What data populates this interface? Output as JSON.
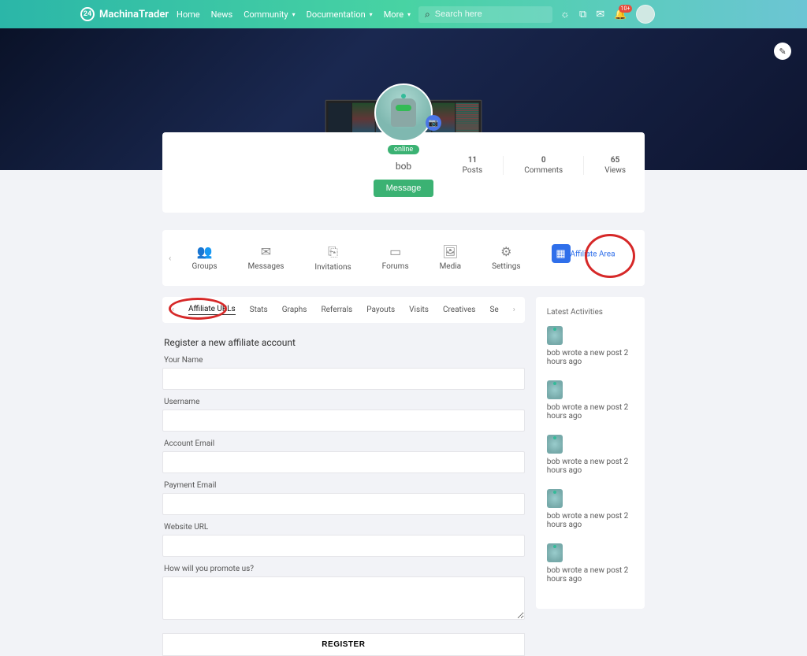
{
  "brand": {
    "name": "MachinaTrader"
  },
  "nav": {
    "home": "Home",
    "news": "News",
    "community": "Community",
    "documentation": "Documentation",
    "more": "More"
  },
  "search": {
    "placeholder": "Search here"
  },
  "notif_badge": "10+",
  "profile": {
    "status": "online",
    "name": "bob",
    "message_btn": "Message",
    "stats": {
      "posts_n": "11",
      "posts_l": "Posts",
      "comments_n": "0",
      "comments_l": "Comments",
      "views_n": "65",
      "views_l": "Views"
    }
  },
  "sections": {
    "groups": "Groups",
    "messages": "Messages",
    "invitations": "Invitations",
    "forums": "Forums",
    "media": "Media",
    "settings": "Settings",
    "affiliate": "Affiliate Area"
  },
  "tabs": {
    "urls": "Affiliate URLs",
    "stats": "Stats",
    "graphs": "Graphs",
    "referrals": "Referrals",
    "payouts": "Payouts",
    "visits": "Visits",
    "creatives": "Creatives",
    "se": "Se"
  },
  "form": {
    "title": "Register a new affiliate account",
    "your_name": "Your Name",
    "username": "Username",
    "account_email": "Account Email",
    "payment_email": "Payment Email",
    "website_url": "Website URL",
    "promote": "How will you promote us?",
    "register": "REGISTER"
  },
  "sidebar": {
    "title": "Latest Activities",
    "items": [
      {
        "text": "bob wrote a new post 2 hours ago"
      },
      {
        "text": "bob wrote a new post 2 hours ago"
      },
      {
        "text": "bob wrote a new post 2 hours ago"
      },
      {
        "text": "bob wrote a new post 2 hours ago"
      },
      {
        "text": "bob wrote a new post 2 hours ago"
      }
    ]
  }
}
